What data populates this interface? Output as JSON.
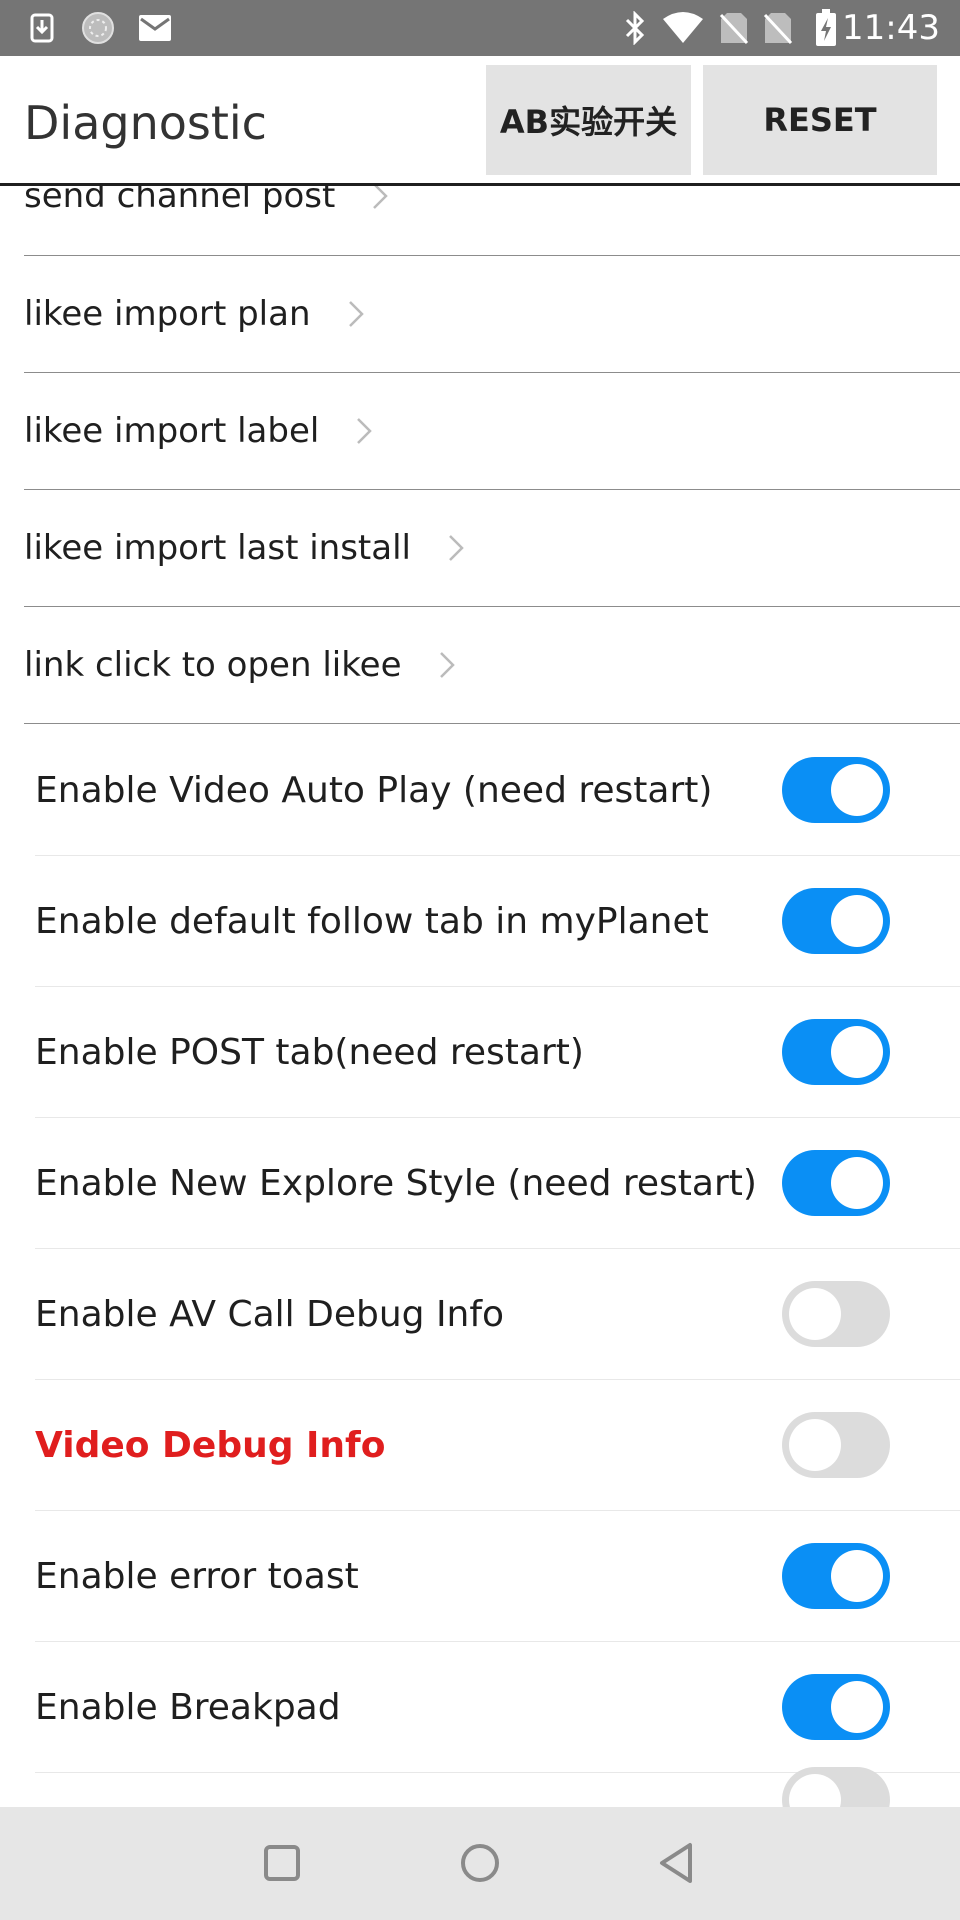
{
  "status_bar": {
    "time": "11:43",
    "left_icons": [
      "download-notification-icon",
      "app-notification-icon",
      "mail-notification-icon"
    ],
    "right_icons": [
      "bluetooth-icon",
      "wifi-icon",
      "no-sim-icon",
      "no-sim-icon",
      "battery-charging-icon"
    ]
  },
  "app_bar": {
    "title": "Diagnostic",
    "ab_button": "AB实验开关",
    "reset_button": "RESET"
  },
  "links": [
    {
      "label": "send channel post"
    },
    {
      "label": "likee import plan"
    },
    {
      "label": "likee import label"
    },
    {
      "label": "likee import last install"
    },
    {
      "label": "link click to open likee"
    }
  ],
  "toggles": [
    {
      "label": "Enable Video Auto Play (need restart)",
      "on": true
    },
    {
      "label": "Enable default follow tab in myPlanet",
      "on": true
    },
    {
      "label": "Enable POST tab(need restart)",
      "on": true
    },
    {
      "label": "Enable New Explore Style (need restart)",
      "on": true
    },
    {
      "label": "Enable AV Call Debug Info",
      "on": false
    },
    {
      "label": "Video Debug Info",
      "on": false,
      "highlight": "#e01e1e"
    },
    {
      "label": "Enable error toast",
      "on": true
    },
    {
      "label": "Enable Breakpad",
      "on": true
    }
  ],
  "colors": {
    "switch_on": "#0a8ff5",
    "switch_off": "#dcdcdc",
    "status_bar": "#757575",
    "warning_text": "#e01e1e"
  },
  "nav_bar": {
    "buttons": [
      "recents-square-icon",
      "home-circle-icon",
      "back-triangle-icon"
    ]
  }
}
